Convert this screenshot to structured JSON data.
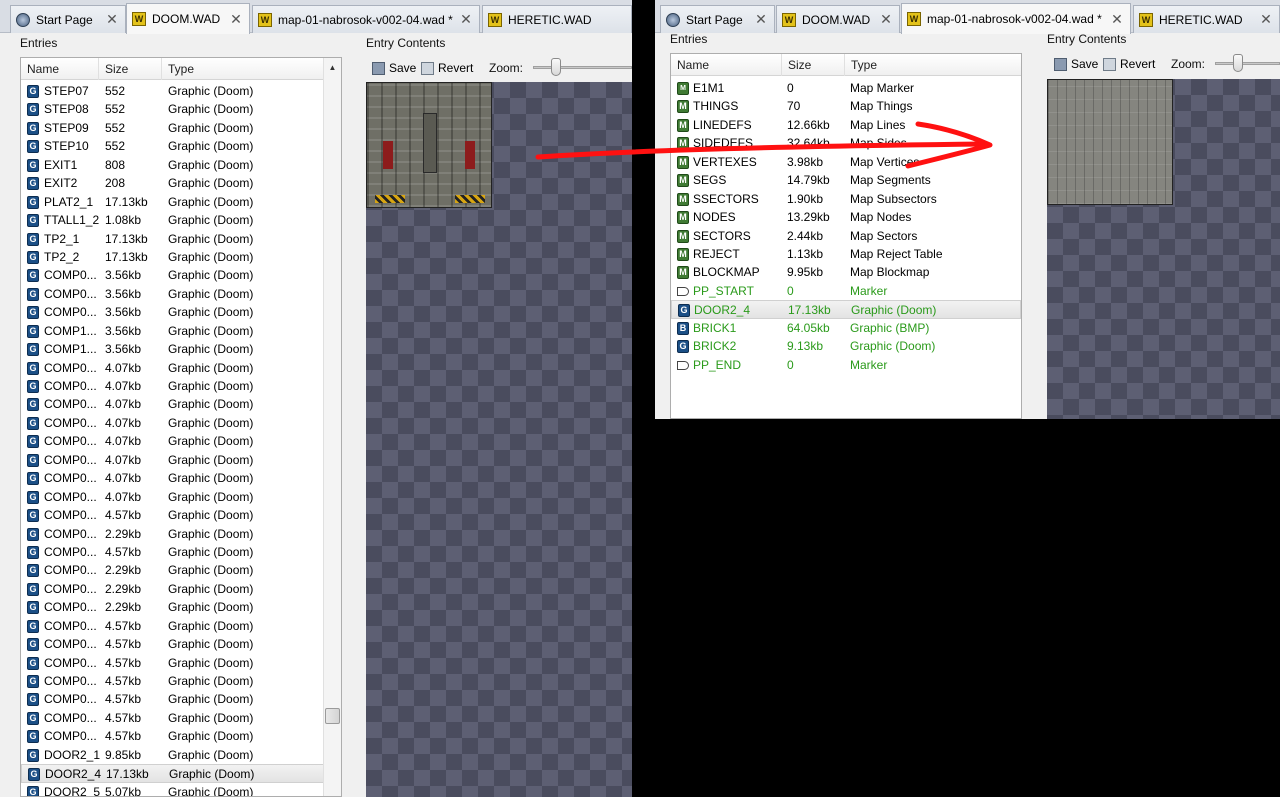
{
  "colors": {
    "arrow": "#ff1111",
    "green_text": "#2a9a1a",
    "wad_icon": "#e3c21a",
    "graphic_icon": "#1b4f86",
    "map_icon": "#3f7a33"
  },
  "left": {
    "tabs": [
      {
        "label": "Start Page",
        "icon": "start-page-icon",
        "active": false
      },
      {
        "label": "DOOM.WAD",
        "icon": "wad-icon",
        "active": true
      },
      {
        "label": "map-01-nabrosok-v002-04.wad *",
        "icon": "wad-icon",
        "active": false
      },
      {
        "label": "HERETIC.WAD",
        "icon": "wad-icon",
        "active": false
      }
    ],
    "entries_label": "Entries",
    "columns": [
      "Name",
      "Size",
      "Type"
    ],
    "rows": [
      {
        "icon": "g",
        "name": "STEP07",
        "size": "552",
        "type": "Graphic (Doom)"
      },
      {
        "icon": "g",
        "name": "STEP08",
        "size": "552",
        "type": "Graphic (Doom)"
      },
      {
        "icon": "g",
        "name": "STEP09",
        "size": "552",
        "type": "Graphic (Doom)"
      },
      {
        "icon": "g",
        "name": "STEP10",
        "size": "552",
        "type": "Graphic (Doom)"
      },
      {
        "icon": "g",
        "name": "EXIT1",
        "size": "808",
        "type": "Graphic (Doom)"
      },
      {
        "icon": "g",
        "name": "EXIT2",
        "size": "208",
        "type": "Graphic (Doom)"
      },
      {
        "icon": "g",
        "name": "PLAT2_1",
        "size": "17.13kb",
        "type": "Graphic (Doom)"
      },
      {
        "icon": "g",
        "name": "TTALL1_2",
        "size": "1.08kb",
        "type": "Graphic (Doom)"
      },
      {
        "icon": "g",
        "name": "TP2_1",
        "size": "17.13kb",
        "type": "Graphic (Doom)"
      },
      {
        "icon": "g",
        "name": "TP2_2",
        "size": "17.13kb",
        "type": "Graphic (Doom)"
      },
      {
        "icon": "g",
        "name": "COMP0...",
        "size": "3.56kb",
        "type": "Graphic (Doom)"
      },
      {
        "icon": "g",
        "name": "COMP0...",
        "size": "3.56kb",
        "type": "Graphic (Doom)"
      },
      {
        "icon": "g",
        "name": "COMP0...",
        "size": "3.56kb",
        "type": "Graphic (Doom)"
      },
      {
        "icon": "g",
        "name": "COMP1...",
        "size": "3.56kb",
        "type": "Graphic (Doom)"
      },
      {
        "icon": "g",
        "name": "COMP1...",
        "size": "3.56kb",
        "type": "Graphic (Doom)"
      },
      {
        "icon": "g",
        "name": "COMP0...",
        "size": "4.07kb",
        "type": "Graphic (Doom)"
      },
      {
        "icon": "g",
        "name": "COMP0...",
        "size": "4.07kb",
        "type": "Graphic (Doom)"
      },
      {
        "icon": "g",
        "name": "COMP0...",
        "size": "4.07kb",
        "type": "Graphic (Doom)"
      },
      {
        "icon": "g",
        "name": "COMP0...",
        "size": "4.07kb",
        "type": "Graphic (Doom)"
      },
      {
        "icon": "g",
        "name": "COMP0...",
        "size": "4.07kb",
        "type": "Graphic (Doom)"
      },
      {
        "icon": "g",
        "name": "COMP0...",
        "size": "4.07kb",
        "type": "Graphic (Doom)"
      },
      {
        "icon": "g",
        "name": "COMP0...",
        "size": "4.07kb",
        "type": "Graphic (Doom)"
      },
      {
        "icon": "g",
        "name": "COMP0...",
        "size": "4.07kb",
        "type": "Graphic (Doom)"
      },
      {
        "icon": "g",
        "name": "COMP0...",
        "size": "4.57kb",
        "type": "Graphic (Doom)"
      },
      {
        "icon": "g",
        "name": "COMP0...",
        "size": "2.29kb",
        "type": "Graphic (Doom)"
      },
      {
        "icon": "g",
        "name": "COMP0...",
        "size": "4.57kb",
        "type": "Graphic (Doom)"
      },
      {
        "icon": "g",
        "name": "COMP0...",
        "size": "2.29kb",
        "type": "Graphic (Doom)"
      },
      {
        "icon": "g",
        "name": "COMP0...",
        "size": "2.29kb",
        "type": "Graphic (Doom)"
      },
      {
        "icon": "g",
        "name": "COMP0...",
        "size": "2.29kb",
        "type": "Graphic (Doom)"
      },
      {
        "icon": "g",
        "name": "COMP0...",
        "size": "4.57kb",
        "type": "Graphic (Doom)"
      },
      {
        "icon": "g",
        "name": "COMP0...",
        "size": "4.57kb",
        "type": "Graphic (Doom)"
      },
      {
        "icon": "g",
        "name": "COMP0...",
        "size": "4.57kb",
        "type": "Graphic (Doom)"
      },
      {
        "icon": "g",
        "name": "COMP0...",
        "size": "4.57kb",
        "type": "Graphic (Doom)"
      },
      {
        "icon": "g",
        "name": "COMP0...",
        "size": "4.57kb",
        "type": "Graphic (Doom)"
      },
      {
        "icon": "g",
        "name": "COMP0...",
        "size": "4.57kb",
        "type": "Graphic (Doom)"
      },
      {
        "icon": "g",
        "name": "COMP0...",
        "size": "4.57kb",
        "type": "Graphic (Doom)"
      },
      {
        "icon": "g",
        "name": "DOOR2_1",
        "size": "9.85kb",
        "type": "Graphic (Doom)"
      },
      {
        "icon": "g",
        "name": "DOOR2_4",
        "size": "17.13kb",
        "type": "Graphic (Doom)",
        "selected": true
      },
      {
        "icon": "g",
        "name": "DOOR2_5",
        "size": "5.07kb",
        "type": "Graphic (Doom)"
      }
    ],
    "entry_contents_label": "Entry Contents",
    "save_label": "Save",
    "revert_label": "Revert",
    "zoom_label": "Zoom:"
  },
  "right": {
    "tabs": [
      {
        "label": "Start Page",
        "icon": "start-page-icon",
        "active": false
      },
      {
        "label": "DOOM.WAD",
        "icon": "wad-icon",
        "active": false
      },
      {
        "label": "map-01-nabrosok-v002-04.wad *",
        "icon": "wad-icon",
        "active": true
      },
      {
        "label": "HERETIC.WAD",
        "icon": "wad-icon",
        "active": false
      }
    ],
    "entries_label": "Entries",
    "columns": [
      "Name",
      "Size",
      "Type"
    ],
    "rows": [
      {
        "icon": "mm",
        "name": "E1M1",
        "size": "0",
        "type": "Map Marker"
      },
      {
        "icon": "m",
        "name": "THINGS",
        "size": "70",
        "type": "Map Things"
      },
      {
        "icon": "m",
        "name": "LINEDEFS",
        "size": "12.66kb",
        "type": "Map Lines"
      },
      {
        "icon": "m",
        "name": "SIDEDEFS",
        "size": "32.64kb",
        "type": "Map Sides"
      },
      {
        "icon": "m",
        "name": "VERTEXES",
        "size": "3.98kb",
        "type": "Map Vertices"
      },
      {
        "icon": "m",
        "name": "SEGS",
        "size": "14.79kb",
        "type": "Map Segments"
      },
      {
        "icon": "m",
        "name": "SSECTORS",
        "size": "1.90kb",
        "type": "Map Subsectors"
      },
      {
        "icon": "m",
        "name": "NODES",
        "size": "13.29kb",
        "type": "Map Nodes"
      },
      {
        "icon": "m",
        "name": "SECTORS",
        "size": "2.44kb",
        "type": "Map Sectors"
      },
      {
        "icon": "m",
        "name": "REJECT",
        "size": "1.13kb",
        "type": "Map Reject Table"
      },
      {
        "icon": "m",
        "name": "BLOCKMAP",
        "size": "9.95kb",
        "type": "Map Blockmap"
      },
      {
        "icon": "mk",
        "name": "PP_START",
        "size": "0",
        "type": "Marker",
        "green": true
      },
      {
        "icon": "g",
        "name": "DOOR2_4",
        "size": "17.13kb",
        "type": "Graphic (Doom)",
        "green": true,
        "selected": true
      },
      {
        "icon": "b",
        "name": "BRICK1",
        "size": "64.05kb",
        "type": "Graphic (BMP)",
        "green": true
      },
      {
        "icon": "g",
        "name": "BRICK2",
        "size": "9.13kb",
        "type": "Graphic (Doom)",
        "green": true
      },
      {
        "icon": "mk",
        "name": "PP_END",
        "size": "0",
        "type": "Marker",
        "green": true
      }
    ],
    "entry_contents_label": "Entry Contents",
    "save_label": "Save",
    "revert_label": "Revert",
    "zoom_label": "Zoom:"
  }
}
